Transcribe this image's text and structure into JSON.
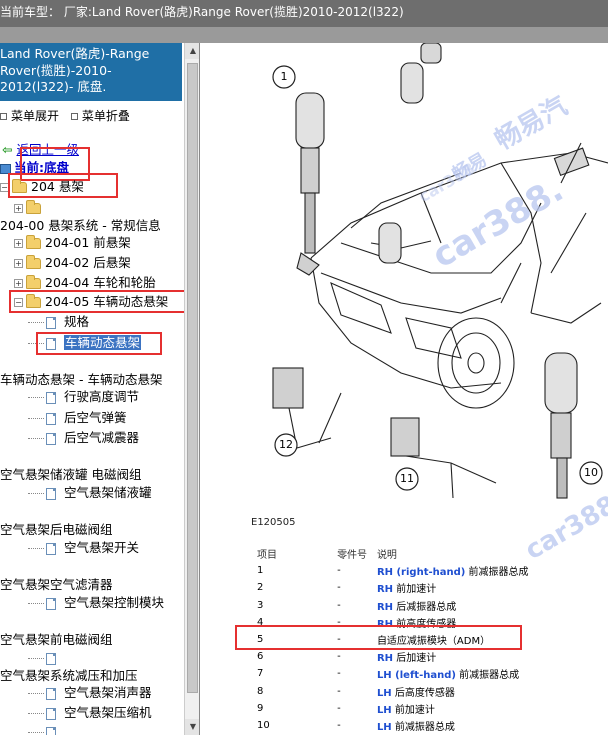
{
  "window": {
    "title": "当前车型：  厂家:Land Rover(路虎)Range Rover(揽胜)2010-2012(l322)"
  },
  "sidebar": {
    "header_lines": [
      "Land Rover(路虎)-Range",
      "Rover(揽胜)-2010-",
      "2012(l322)- 底盘."
    ],
    "expand_all": "菜单展开",
    "collapse_all": "菜单折叠",
    "back_label": "返回上一级",
    "current_label": "当前:底盘",
    "tree": [
      {
        "label": "204 悬架",
        "kind": "folder-open"
      },
      {
        "label": "",
        "kind": "folder-collapsed"
      },
      {
        "label": "204-00 悬架系统 - 常规信息",
        "kind": "text"
      },
      {
        "label": "204-01 前悬架",
        "kind": "folder-collapsed"
      },
      {
        "label": "204-02 后悬架",
        "kind": "folder-collapsed"
      },
      {
        "label": "204-04 车轮和轮胎",
        "kind": "folder-collapsed"
      },
      {
        "label": "204-05 车辆动态悬架",
        "kind": "folder-open"
      },
      {
        "label": "规格",
        "kind": "doc"
      },
      {
        "label": "车辆动态悬架",
        "kind": "doc-selected"
      },
      {
        "label": "车辆动态悬架 - 车辆动态悬架",
        "kind": "text"
      },
      {
        "label": "行驶高度调节",
        "kind": "doc"
      },
      {
        "label": "后空气弹簧",
        "kind": "doc"
      },
      {
        "label": "后空气减震器",
        "kind": "doc"
      },
      {
        "label": "空气悬架储液罐 电磁阀组",
        "kind": "text"
      },
      {
        "label": "空气悬架储液罐",
        "kind": "doc"
      },
      {
        "label": "空气悬架后电磁阀组",
        "kind": "text"
      },
      {
        "label": "空气悬架开关",
        "kind": "doc"
      },
      {
        "label": "空气悬架空气滤清器",
        "kind": "text"
      },
      {
        "label": "空气悬架控制模块",
        "kind": "doc"
      },
      {
        "label": "空气悬架前电磁阀组",
        "kind": "text"
      },
      {
        "label": "",
        "kind": "doc"
      },
      {
        "label": "空气悬架系统减压和加压",
        "kind": "text"
      },
      {
        "label": "空气悬架消声器",
        "kind": "doc"
      },
      {
        "label": "空气悬架压缩机",
        "kind": "doc"
      },
      {
        "label": "",
        "kind": "doc"
      }
    ]
  },
  "diagram": {
    "callouts": [
      "1",
      "12",
      "11",
      "10"
    ],
    "figure_code": "E120505",
    "watermarks": [
      "畅易汽",
      "畅易",
      "car388.",
      "car388",
      "car388"
    ],
    "watermark_color": "#b8c6ef"
  },
  "parts_table": {
    "headers": [
      "项目",
      "零件号",
      "说明"
    ],
    "rows": [
      {
        "item": "1",
        "part": "-",
        "side": "RH (right-hand)",
        "desc": " 前减振器总成"
      },
      {
        "item": "2",
        "part": "-",
        "side": "RH",
        "desc": " 前加速计"
      },
      {
        "item": "3",
        "part": "-",
        "side": "RH",
        "desc": " 后减振器总成"
      },
      {
        "item": "4",
        "part": "-",
        "side": "RH",
        "desc": " 前高度传感器"
      },
      {
        "item": "5",
        "part": "-",
        "side": "",
        "desc": "自适应减振模块（ADM）"
      },
      {
        "item": "6",
        "part": "-",
        "side": "RH",
        "desc": " 后加速计"
      },
      {
        "item": "7",
        "part": "-",
        "side": "LH (left-hand)",
        "desc": " 前减振器总成"
      },
      {
        "item": "8",
        "part": "-",
        "side": "LH",
        "desc": " 后高度传感器"
      },
      {
        "item": "9",
        "part": "-",
        "side": "LH",
        "desc": " 前加速计"
      },
      {
        "item": "10",
        "part": "-",
        "side": "LH",
        "desc": " 前减振器总成"
      }
    ]
  },
  "colors": {
    "header_bg": "#1f6fa6",
    "highlight_box": "#e53030",
    "side_label": "#1f4fd0",
    "selection": "#3b73c2"
  }
}
